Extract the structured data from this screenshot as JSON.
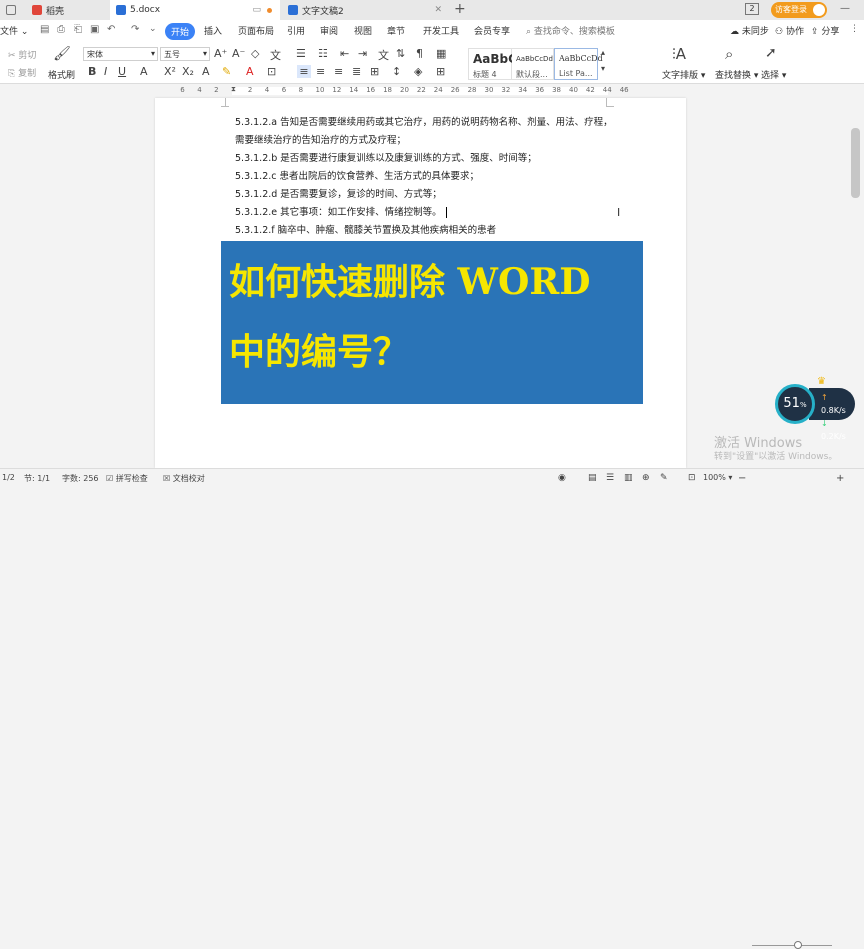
{
  "tabs": [
    {
      "label": "稻壳",
      "icon": "docer-icon",
      "color": "#e0463a"
    },
    {
      "label": "5.docx",
      "icon": "word-doc-icon",
      "color": "#2b6fd6"
    },
    {
      "label": "文字文稿2",
      "icon": "word-doc-icon",
      "color": "#2b6fd6"
    }
  ],
  "titlebar": {
    "login": "访客登录",
    "window_num": "2"
  },
  "menu": {
    "file": "文件",
    "items": [
      "开始",
      "插入",
      "页面布局",
      "引用",
      "审阅",
      "视图",
      "章节",
      "开发工具",
      "会员专享"
    ],
    "search_placeholder": "查找命令、搜索模板",
    "unsynced": "未同步",
    "collab": "协作",
    "share": "分享"
  },
  "ribbon": {
    "cut": "剪切",
    "copy": "复制",
    "format_painter": "格式刷",
    "font_name": "宋体",
    "font_size": "五号",
    "styles": [
      {
        "preview": "AaBbC",
        "name": "标题 4"
      },
      {
        "preview": "AaBbCcDd",
        "name": "默认段..."
      },
      {
        "preview": "AaBbCcDd",
        "name": "List Pa..."
      }
    ],
    "text_layout": "文字排版",
    "find_replace": "查找替换",
    "select": "选择"
  },
  "ruler": [
    "6",
    "4",
    "2",
    "2",
    "4",
    "6",
    "8",
    "10",
    "12",
    "14",
    "16",
    "18",
    "20",
    "22",
    "24",
    "26",
    "28",
    "30",
    "32",
    "34",
    "36",
    "38",
    "40",
    "42",
    "44",
    "46"
  ],
  "document": {
    "lines": [
      "5.3.1.2.a 告知是否需要继续用药或其它治疗，用药的说明药物名称、剂量、用法、疗程，",
      "需要继续治疗的告知治疗的方式及疗程；",
      "5.3.1.2.b 是否需要进行康复训练以及康复训练的方式、强度、时间等；",
      "5.3.1.2.c 患者出院后的饮食营养、生活方式的具体要求；",
      "5.3.1.2.d 是否需要复诊，复诊的时间、方式等；",
      "5.3.1.2.e 其它事项：如工作安排、情绪控制等。",
      "5.3.1.2.f 脑卒中、肿瘤、髋膝关节置换及其他疾病相关的患者"
    ]
  },
  "overlay": {
    "line1": "如何快速删除 WORD",
    "line2": "中的编号？",
    "bg": "#2a74b7",
    "fg": "#f6e600"
  },
  "status": {
    "page": "页码: 1",
    "pages": "1/2",
    "section": "节: 1/1",
    "words": "字数: 256",
    "spell": "拼写检查",
    "proof": "文档校对",
    "zoom": "100%"
  },
  "speed": {
    "percent": "51",
    "unit": "%",
    "up": "0.8K/s",
    "down": "0.2K/s"
  },
  "watermark": {
    "line1": "激活 Windows",
    "line2": "转到\"设置\"以激活 Windows。"
  }
}
